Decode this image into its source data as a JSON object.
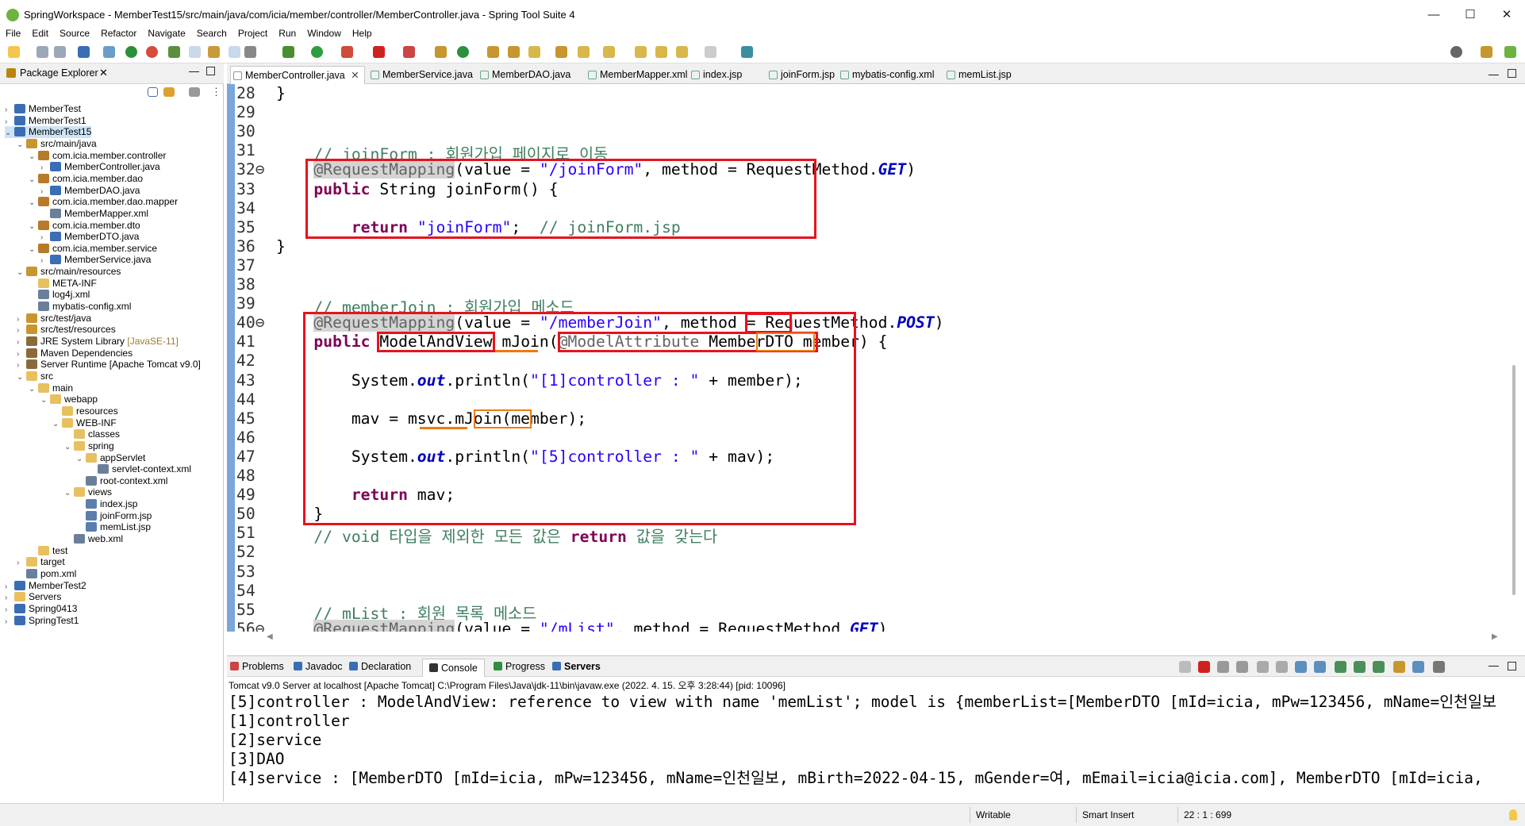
{
  "window": {
    "title": "SpringWorkspace - MemberTest15/src/main/java/com/icia/member/controller/MemberController.java - Spring Tool Suite 4",
    "minimize": "—",
    "maximize": "☐",
    "close": "✕"
  },
  "menu": [
    "File",
    "Edit",
    "Source",
    "Refactor",
    "Navigate",
    "Search",
    "Project",
    "Run",
    "Window",
    "Help"
  ],
  "package_explorer": {
    "title": "Package Explorer",
    "tree": [
      {
        "label": "MemberTest",
        "depth": 0,
        "arrow": "›",
        "icon": "project"
      },
      {
        "label": "MemberTest1",
        "depth": 0,
        "arrow": "›",
        "icon": "project"
      },
      {
        "label": "MemberTest15",
        "depth": 0,
        "arrow": "⌄",
        "icon": "project",
        "selected": true
      },
      {
        "label": "src/main/java",
        "depth": 1,
        "arrow": "⌄",
        "icon": "srcfolder"
      },
      {
        "label": "com.icia.member.controller",
        "depth": 2,
        "arrow": "⌄",
        "icon": "package"
      },
      {
        "label": "MemberController.java",
        "depth": 3,
        "arrow": "›",
        "icon": "java"
      },
      {
        "label": "com.icia.member.dao",
        "depth": 2,
        "arrow": "⌄",
        "icon": "package"
      },
      {
        "label": "MemberDAO.java",
        "depth": 3,
        "arrow": "›",
        "icon": "java"
      },
      {
        "label": "com.icia.member.dao.mapper",
        "depth": 2,
        "arrow": "⌄",
        "icon": "package"
      },
      {
        "label": "MemberMapper.xml",
        "depth": 3,
        "arrow": "",
        "icon": "xml"
      },
      {
        "label": "com.icia.member.dto",
        "depth": 2,
        "arrow": "⌄",
        "icon": "package"
      },
      {
        "label": "MemberDTO.java",
        "depth": 3,
        "arrow": "›",
        "icon": "java"
      },
      {
        "label": "com.icia.member.service",
        "depth": 2,
        "arrow": "⌄",
        "icon": "package"
      },
      {
        "label": "MemberService.java",
        "depth": 3,
        "arrow": "›",
        "icon": "java"
      },
      {
        "label": "src/main/resources",
        "depth": 1,
        "arrow": "⌄",
        "icon": "srcfolder"
      },
      {
        "label": "META-INF",
        "depth": 2,
        "arrow": "",
        "icon": "folder"
      },
      {
        "label": "log4j.xml",
        "depth": 2,
        "arrow": "",
        "icon": "xml"
      },
      {
        "label": "mybatis-config.xml",
        "depth": 2,
        "arrow": "",
        "icon": "xml"
      },
      {
        "label": "src/test/java",
        "depth": 1,
        "arrow": "›",
        "icon": "srcfolder"
      },
      {
        "label": "src/test/resources",
        "depth": 1,
        "arrow": "›",
        "icon": "srcfolder"
      },
      {
        "label": "JRE System Library",
        "note": "[JavaSE-11]",
        "depth": 1,
        "arrow": "›",
        "icon": "lib"
      },
      {
        "label": "Maven Dependencies",
        "depth": 1,
        "arrow": "›",
        "icon": "lib"
      },
      {
        "label": "Server Runtime [Apache Tomcat v9.0]",
        "depth": 1,
        "arrow": "›",
        "icon": "lib"
      },
      {
        "label": "src",
        "depth": 1,
        "arrow": "⌄",
        "icon": "folder"
      },
      {
        "label": "main",
        "depth": 2,
        "arrow": "⌄",
        "icon": "folder"
      },
      {
        "label": "webapp",
        "depth": 3,
        "arrow": "⌄",
        "icon": "folder"
      },
      {
        "label": "resources",
        "depth": 4,
        "arrow": "",
        "icon": "folder"
      },
      {
        "label": "WEB-INF",
        "depth": 4,
        "arrow": "⌄",
        "icon": "folder"
      },
      {
        "label": "classes",
        "depth": 5,
        "arrow": "",
        "icon": "folder"
      },
      {
        "label": "spring",
        "depth": 5,
        "arrow": "⌄",
        "icon": "folder"
      },
      {
        "label": "appServlet",
        "depth": 6,
        "arrow": "⌄",
        "icon": "folder"
      },
      {
        "label": "servlet-context.xml",
        "depth": 7,
        "arrow": "",
        "icon": "xml"
      },
      {
        "label": "root-context.xml",
        "depth": 6,
        "arrow": "",
        "icon": "xml"
      },
      {
        "label": "views",
        "depth": 5,
        "arrow": "⌄",
        "icon": "folder"
      },
      {
        "label": "index.jsp",
        "depth": 6,
        "arrow": "",
        "icon": "jsp"
      },
      {
        "label": "joinForm.jsp",
        "depth": 6,
        "arrow": "",
        "icon": "jsp"
      },
      {
        "label": "memList.jsp",
        "depth": 6,
        "arrow": "",
        "icon": "jsp"
      },
      {
        "label": "web.xml",
        "depth": 5,
        "arrow": "",
        "icon": "xml"
      },
      {
        "label": "test",
        "depth": 2,
        "arrow": "",
        "icon": "folder"
      },
      {
        "label": "target",
        "depth": 1,
        "arrow": "›",
        "icon": "folder"
      },
      {
        "label": "pom.xml",
        "depth": 1,
        "arrow": "",
        "icon": "xml"
      },
      {
        "label": "MemberTest2",
        "depth": 0,
        "arrow": "›",
        "icon": "project"
      },
      {
        "label": "Servers",
        "depth": 0,
        "arrow": "›",
        "icon": "folder"
      },
      {
        "label": "Spring0413",
        "depth": 0,
        "arrow": "›",
        "icon": "project"
      },
      {
        "label": "SpringTest1",
        "depth": 0,
        "arrow": "›",
        "icon": "project"
      }
    ]
  },
  "editor_tabs": [
    {
      "label": "MemberController.java",
      "active": true
    },
    {
      "label": "MemberService.java"
    },
    {
      "label": "MemberDAO.java"
    },
    {
      "label": "MemberMapper.xml"
    },
    {
      "label": "index.jsp"
    },
    {
      "label": "joinForm.jsp"
    },
    {
      "label": "mybatis-config.xml"
    },
    {
      "label": "memList.jsp"
    }
  ],
  "code": {
    "line_numbers": [
      "28",
      "29",
      "30",
      "31",
      "32⊖",
      "33",
      "34",
      "35",
      "36",
      "37",
      "38",
      "39",
      "40⊖",
      "41",
      "42",
      "43",
      "44",
      "45",
      "46",
      "47",
      "48",
      "49",
      "50",
      "51",
      "52",
      "53",
      "54",
      "55",
      "56⊖"
    ],
    "lines": [
      [
        [
          "}",
          "p"
        ]
      ],
      [],
      [],
      [
        [
          "    // joinForm : 회원가입 페이지로 이동",
          "cm"
        ]
      ],
      [
        [
          "    ",
          "p"
        ],
        [
          "@RequestMapping",
          "an hl-ann"
        ],
        [
          "(value = ",
          "p"
        ],
        [
          "\"/joinForm\"",
          "str"
        ],
        [
          ", method = RequestMethod.",
          "p"
        ],
        [
          "GET",
          "it"
        ],
        [
          ")",
          "p"
        ]
      ],
      [
        [
          "    ",
          "p"
        ],
        [
          "public",
          "kw"
        ],
        [
          " String joinForm() {",
          "p"
        ]
      ],
      [],
      [
        [
          "        ",
          "p"
        ],
        [
          "return",
          "kw"
        ],
        [
          " ",
          "p"
        ],
        [
          "\"joinForm\"",
          "str"
        ],
        [
          ";  ",
          "p"
        ],
        [
          "// joinForm.jsp",
          "cm"
        ]
      ],
      [
        [
          "}",
          "p"
        ]
      ],
      [],
      [],
      [
        [
          "    // memberJoin : 회원가입 메소드",
          "cm"
        ]
      ],
      [
        [
          "    ",
          "p"
        ],
        [
          "@RequestMapping",
          "an hl-ann"
        ],
        [
          "(value = ",
          "p"
        ],
        [
          "\"/memberJoin\"",
          "str"
        ],
        [
          ", method = RequestMethod.",
          "p"
        ],
        [
          "POST",
          "it"
        ],
        [
          ")",
          "p"
        ]
      ],
      [
        [
          "    ",
          "p"
        ],
        [
          "public",
          "kw"
        ],
        [
          " ModelAndView mJoin(",
          "p"
        ],
        [
          "@ModelAttribute",
          "an"
        ],
        [
          " MemberDTO member) {",
          "p"
        ]
      ],
      [],
      [
        [
          "        System.",
          "p"
        ],
        [
          "out",
          "it"
        ],
        [
          ".println(",
          "p"
        ],
        [
          "\"[1]controller : \"",
          "str"
        ],
        [
          " + member);",
          "p"
        ]
      ],
      [],
      [
        [
          "        mav = msvc.mJoin(member);",
          "p"
        ]
      ],
      [],
      [
        [
          "        System.",
          "p"
        ],
        [
          "out",
          "it"
        ],
        [
          ".println(",
          "p"
        ],
        [
          "\"[5]controller : \"",
          "str"
        ],
        [
          " + mav);",
          "p"
        ]
      ],
      [],
      [
        [
          "        ",
          "p"
        ],
        [
          "return",
          "kw"
        ],
        [
          " mav;",
          "p"
        ]
      ],
      [
        [
          "    }",
          "p"
        ]
      ],
      [
        [
          "    // void 타입을 제외한 모든 값은 ",
          "cm"
        ],
        [
          "return",
          "kw"
        ],
        [
          " 값을 갖는다",
          "cm"
        ]
      ],
      [],
      [],
      [],
      [
        [
          "    // mList : 회원 목록 메소드",
          "cm"
        ]
      ],
      [
        [
          "    ",
          "p"
        ],
        [
          "@RequestMapping",
          "an hl-ann"
        ],
        [
          "(value = ",
          "p"
        ],
        [
          "\"/mList\"",
          "str"
        ],
        [
          ", method = RequestMethod.",
          "p"
        ],
        [
          "GET",
          "it"
        ],
        [
          ")",
          "p"
        ]
      ]
    ]
  },
  "console": {
    "tabs": [
      "Problems",
      "Javadoc",
      "Declaration",
      "Console",
      "Progress",
      "Servers"
    ],
    "active_tab": "Console",
    "description": "Tomcat v9.0 Server at localhost [Apache Tomcat] C:\\Program Files\\Java\\jdk-11\\bin\\javaw.exe  (2022. 4. 15. 오후 3:28:44) [pid: 10096]",
    "lines": [
      "[5]controller : ModelAndView: reference to view with name 'memList'; model is {memberList=[MemberDTO [mId=icia, mPw=123456, mName=인천일보",
      "[1]controller",
      "[2]service",
      "[3]DAO",
      "[4]service : [MemberDTO [mId=icia, mPw=123456, mName=인천일보, mBirth=2022-04-15, mGender=여, mEmail=icia@icia.com], MemberDTO [mId=icia,"
    ]
  },
  "status": {
    "writable": "Writable",
    "insert_mode": "Smart Insert",
    "position": "22 : 1 : 699"
  },
  "colors": {
    "highlight_box": "#e8121e",
    "underline": "#f07a10",
    "comment": "#3f7f5f",
    "keyword": "#7f0055",
    "string": "#2a00ff"
  }
}
